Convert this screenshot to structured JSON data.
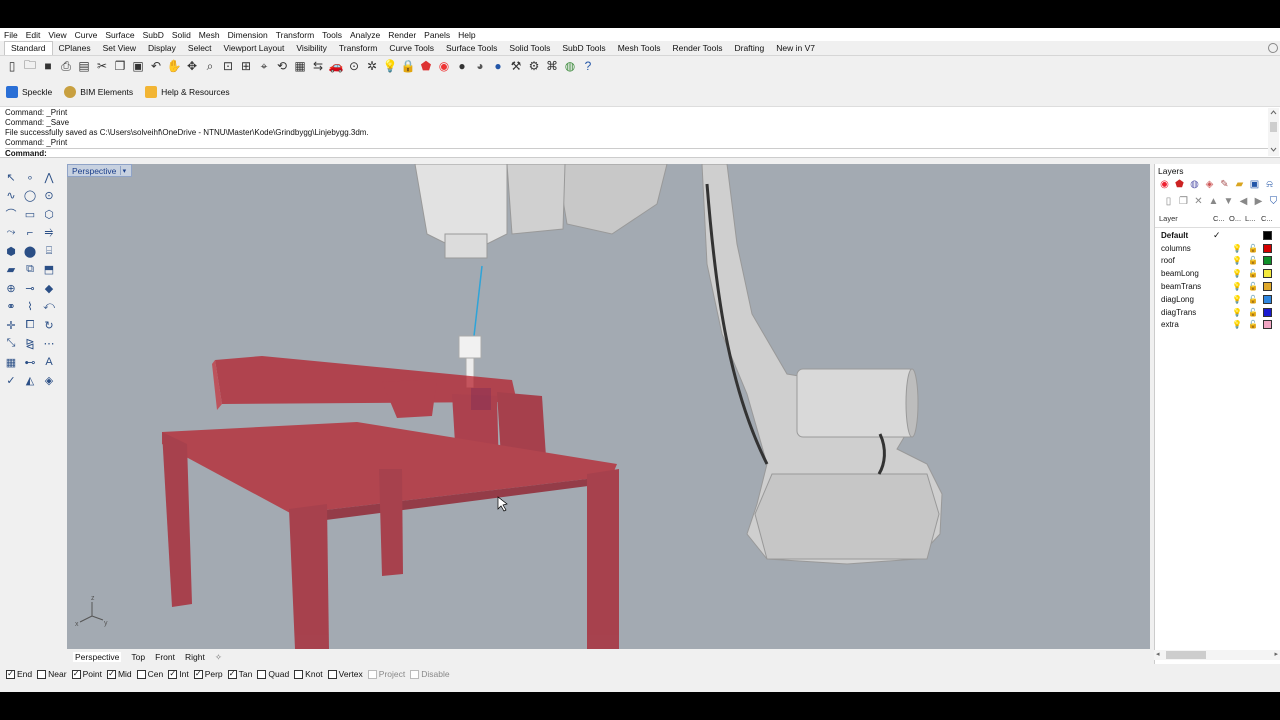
{
  "menu": [
    "File",
    "Edit",
    "View",
    "Curve",
    "Surface",
    "SubD",
    "Solid",
    "Mesh",
    "Dimension",
    "Transform",
    "Tools",
    "Analyze",
    "Render",
    "Panels",
    "Help"
  ],
  "tabs": [
    "Standard",
    "CPlanes",
    "Set View",
    "Display",
    "Select",
    "Viewport Layout",
    "Visibility",
    "Transform",
    "Curve Tools",
    "Surface Tools",
    "Solid Tools",
    "SubD Tools",
    "Mesh Tools",
    "Render Tools",
    "Drafting",
    "New in V7"
  ],
  "active_tab": "Standard",
  "plugins": {
    "speckle": "Speckle",
    "bim": "BIM Elements",
    "help": "Help & Resources"
  },
  "command_history": [
    "Command: _Print",
    "Command: _Save",
    "File successfully saved as C:\\Users\\solveihf\\OneDrive - NTNU\\Master\\Kode\\Grindbygg\\Linjebygg.3dm.",
    "Command: _Print"
  ],
  "command_prompt": "Command:",
  "viewport": {
    "title": "Perspective",
    "tabs": [
      "Perspective",
      "Top",
      "Front",
      "Right"
    ],
    "active_tab": "Perspective",
    "axis_x": "x",
    "axis_y": "y",
    "axis_z": "z"
  },
  "osnaps": [
    {
      "label": "End",
      "checked": true,
      "disabled": false
    },
    {
      "label": "Near",
      "checked": false,
      "disabled": false
    },
    {
      "label": "Point",
      "checked": true,
      "disabled": false
    },
    {
      "label": "Mid",
      "checked": true,
      "disabled": false
    },
    {
      "label": "Cen",
      "checked": false,
      "disabled": false
    },
    {
      "label": "Int",
      "checked": true,
      "disabled": false
    },
    {
      "label": "Perp",
      "checked": true,
      "disabled": false
    },
    {
      "label": "Tan",
      "checked": true,
      "disabled": false
    },
    {
      "label": "Quad",
      "checked": false,
      "disabled": false
    },
    {
      "label": "Knot",
      "checked": false,
      "disabled": false
    },
    {
      "label": "Vertex",
      "checked": false,
      "disabled": false
    },
    {
      "label": "Project",
      "checked": false,
      "disabled": true
    },
    {
      "label": "Disable",
      "checked": false,
      "disabled": true
    }
  ],
  "layers": {
    "title": "Layers",
    "header": {
      "name": "Layer",
      "current": "C...",
      "visible": "O...",
      "locked": "L...",
      "color": "C..."
    },
    "rows": [
      {
        "name": "Default",
        "current": true,
        "color": "#000000"
      },
      {
        "name": "columns",
        "current": false,
        "color": "#d40000"
      },
      {
        "name": "roof",
        "current": false,
        "color": "#0f8f2a"
      },
      {
        "name": "beamLong",
        "current": false,
        "color": "#f4ea3c"
      },
      {
        "name": "beamTrans",
        "current": false,
        "color": "#e0a82a"
      },
      {
        "name": "diagLong",
        "current": false,
        "color": "#2e86e0"
      },
      {
        "name": "diagTrans",
        "current": false,
        "color": "#1a1ad0"
      },
      {
        "name": "extra",
        "current": false,
        "color": "#f2a6c4"
      }
    ]
  }
}
